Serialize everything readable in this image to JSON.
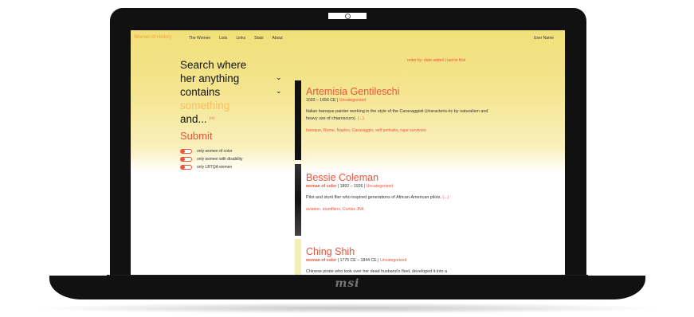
{
  "device": {
    "brand": "msi"
  },
  "nav": {
    "logo": "Women of History",
    "links": [
      "The Women",
      "Lists",
      "Links",
      "Stats",
      "About"
    ],
    "user": "User Name"
  },
  "search": {
    "line1": "Search where",
    "line2": "her anything",
    "line3": "contains",
    "line4": "something",
    "line5": "and...",
    "hint": "(+)",
    "chevron": "⌄",
    "submit": "Submit",
    "filters": [
      "only women of color",
      "only women with disability",
      "only LBTQA women"
    ]
  },
  "order": "order by: date added | last to first",
  "entries": [
    {
      "name": "Artemisia Gentileschi",
      "tag": "",
      "dates": "1593 – 1656 CE | ",
      "category": "Uncategorized",
      "desc": "Italian baroque painter working in the style of the Caravaggisti (characteris-tic by naturalism and heavy use of chiaroscuro).",
      "more": "(...)",
      "tags": "baroque, Rome, Naples, Caravaggio, self portraits, rape survivors"
    },
    {
      "name": "Bessie Coleman",
      "tag": "woman of color",
      "dates": " | 1892 – 1926 | ",
      "category": "Uncategorized",
      "desc": "Pilot and stunt flier who inspired generations of African-American pilots.",
      "more": "(...)",
      "tags": "aviation, stuntfliers, Curtiss JN4,"
    },
    {
      "name": "Ching Shih",
      "tag": "woman of color",
      "dates": " | 1775 CE – 1844 CE | ",
      "category": "Uncategorized",
      "desc": "Chinese pirate who took over her dead husband's fleet, developed it into a",
      "more": "",
      "tags": ""
    }
  ]
}
